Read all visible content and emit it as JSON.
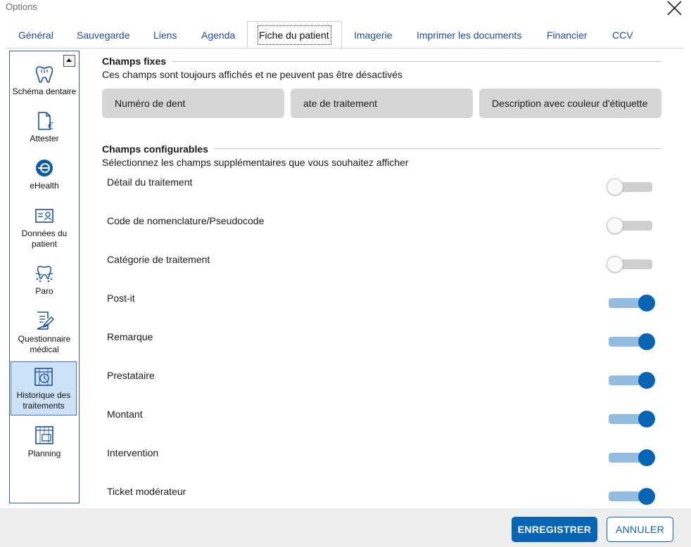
{
  "window": {
    "title": "Options"
  },
  "tabs": [
    {
      "label": "Général"
    },
    {
      "label": "Sauvegarde"
    },
    {
      "label": "Liens"
    },
    {
      "label": "Agenda"
    },
    {
      "label": "Fiche du patient",
      "active": true
    },
    {
      "label": "Imagerie"
    },
    {
      "label": "Imprimer les documents"
    },
    {
      "label": "Financier"
    },
    {
      "label": "CCV"
    }
  ],
  "sidebar": {
    "items": [
      {
        "label": "Schéma dentaire",
        "icon": "tooth-icon"
      },
      {
        "label": "Attester",
        "icon": "euro-document-icon"
      },
      {
        "label": "eHealth",
        "icon": "ehealth-icon"
      },
      {
        "label": "Données du patient",
        "icon": "id-card-icon"
      },
      {
        "label": "Paro",
        "icon": "gum-tooth-icon"
      },
      {
        "label": "Questionnaire médical",
        "icon": "questionnaire-icon"
      },
      {
        "label": "Historique des traitements",
        "icon": "history-calendar-icon",
        "selected": true
      },
      {
        "label": "Planning",
        "icon": "calendar-icon"
      }
    ]
  },
  "fixed_fields": {
    "title": "Champs fixes",
    "description": "Ces champs sont toujours affichés et ne peuvent pas être désactivés",
    "chips": [
      "Numéro de dent",
      "ate de traitement",
      "Description avec couleur d'étiquette"
    ]
  },
  "configurable_fields": {
    "title": "Champs configurables",
    "description": "Sélectionnez les champs supplémentaires que vous souhaitez afficher",
    "fields": [
      {
        "label": "Détail du traitement",
        "enabled": false
      },
      {
        "label": "Code de nomenclature/Pseudocode",
        "enabled": false
      },
      {
        "label": "Catégorie de traitement",
        "enabled": false
      },
      {
        "label": "Post-it",
        "enabled": true
      },
      {
        "label": "Remarque",
        "enabled": true
      },
      {
        "label": "Prestataire",
        "enabled": true
      },
      {
        "label": "Montant",
        "enabled": true
      },
      {
        "label": "Intervention",
        "enabled": true
      },
      {
        "label": "Ticket modérateur",
        "enabled": true
      }
    ]
  },
  "footer": {
    "save_label": "ENREGISTRER",
    "cancel_label": "ANNULER"
  },
  "colors": {
    "accent": "#0a64b4",
    "toggle_on_track": "#93bde0",
    "toggle_off_track": "#cfcfcf",
    "sidebar_selected": "#cde1f7"
  }
}
